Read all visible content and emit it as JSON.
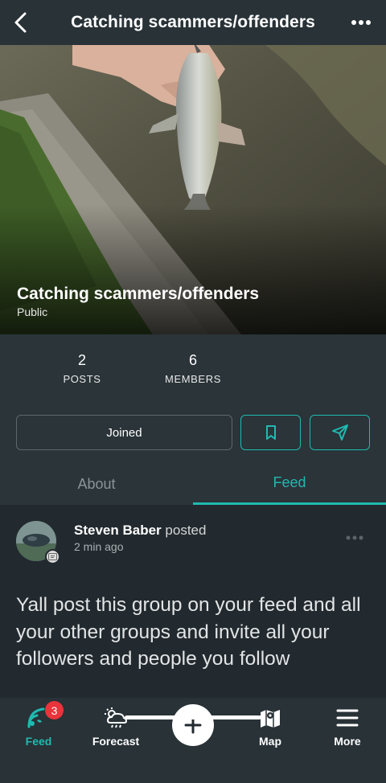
{
  "header": {
    "title": "Catching scammers/offenders",
    "back_icon": "chevron-left-icon",
    "menu_icon": "more-horizontal-icon"
  },
  "hero": {
    "group_name": "Catching scammers/offenders",
    "visibility": "Public"
  },
  "stats": {
    "posts_count": "2",
    "posts_label": "POSTS",
    "members_count": "6",
    "members_label": "MEMBERS"
  },
  "actions": {
    "joined_label": "Joined",
    "bookmark_icon": "bookmark-icon",
    "share_icon": "send-icon"
  },
  "tabs": [
    {
      "label": "About",
      "active": false
    },
    {
      "label": "Feed",
      "active": true
    }
  ],
  "post": {
    "author": "Steven Baber",
    "action": "posted",
    "time": "2 min ago",
    "text": "Yall post this group on your feed and all your other groups and invite all your followers and people you follow"
  },
  "bottom_nav": {
    "items": [
      {
        "label": "Feed",
        "icon": "feed-icon",
        "active": true,
        "badge": "3"
      },
      {
        "label": "Forecast",
        "icon": "weather-icon",
        "active": false
      },
      {
        "label": "",
        "icon": "plus-icon",
        "active": false
      },
      {
        "label": "Map",
        "icon": "map-icon",
        "active": false
      },
      {
        "label": "More",
        "icon": "menu-icon",
        "active": false
      }
    ]
  },
  "colors": {
    "accent": "#1fbab0",
    "background": "#222a2f",
    "panel": "#2a3439",
    "badge": "#e8343a"
  }
}
